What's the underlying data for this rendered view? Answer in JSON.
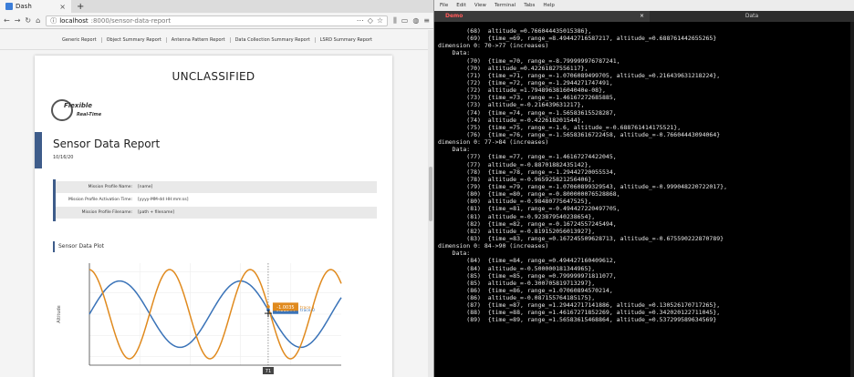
{
  "browser": {
    "tab_title": "Dash",
    "url_host": "localhost",
    "url_rest": ":8000/sensor-data-report"
  },
  "report_nav": [
    "Generic Report",
    "Object Summary Report",
    "Antenna Pattern Report",
    "Data Collection Summary Report",
    "LSRD Summary Report"
  ],
  "report": {
    "classification": "UNCLASSIFIED",
    "logo_brand": "Flexible",
    "logo_sub": "Real-Time",
    "title": "Sensor Data Report",
    "date": "10/16/20",
    "profile": [
      {
        "key": "Mission Profile Name:",
        "value": "[name]"
      },
      {
        "key": "Mission Profile Activation Time:",
        "value": "[yyyy-MM-dd HH:mm:ss]"
      },
      {
        "key": "Mission Profile Filename:",
        "value": "[path + filename]"
      }
    ],
    "plot_heading": "Sensor Data Plot"
  },
  "chart_data": {
    "type": "line",
    "xlabel": "Time (s)",
    "ylabel": "Altitude",
    "xlim": [
      0,
      100
    ],
    "ylim": [
      -1.2,
      1.2
    ],
    "series": [
      {
        "name": "trace 0",
        "color": "#3a73b8",
        "amplitude": 0.78,
        "period": 48,
        "phase": 0.0
      },
      {
        "name": "trace 1",
        "color": "#e08a1e",
        "amplitude": 1.05,
        "period": 32,
        "phase": 1.6
      }
    ],
    "hover": {
      "x": 71,
      "labels": [
        {
          "series": "trace 0",
          "value": "0.21844"
        },
        {
          "series": "trace 1",
          "value": "-1.0035"
        }
      ],
      "x_label": "71"
    }
  },
  "terminal": {
    "menu": [
      "File",
      "Edit",
      "View",
      "Terminal",
      "Tabs",
      "Help"
    ],
    "tabs": [
      {
        "label": "Demo",
        "active": true
      },
      {
        "label": "Data",
        "active": false
      }
    ],
    "close_glyph": "×",
    "lines": [
      "        (68)  altitude_=0.766044435015386},",
      "        (69)  {time_=69, range_=8.49442716587217, altitude_=0.688761442655265}",
      "dimension 0: 70->77 (increases)",
      "    Data:",
      "        (70)  {time_=70, range_=-8.799999976787241,",
      "        (70)  altitude_=0.42261827556117},",
      "        (71)  {time_=71, range_=-1.0706089499705, altitude_=0.216439631218224},",
      "        (72)  {time_=72, range_=-1.2944271747491,",
      "        (72)  altitude_=1.794896381604040e-08},",
      "        (73)  {time_=73, range_=-1.46167272685885,",
      "        (73)  altitude_=-0.216439631217},",
      "        (74)  {time_=74, range_=-1.56583615528287,",
      "        (74)  altitude_=-0.422618201544},",
      "        (75)  {time_=75, range_=-1.6, altitude_=-0.688761414175521},",
      "        (76)  {time_=76, range_=-1.56583616722458, altitude_=-0.76604443094064}",
      "dimension 0: 77->84 (increases)",
      "    Data:",
      "        (77)  {time_=77, range_=-1.46167274422045,",
      "        (77)  altitude_=-0.88701882435142},",
      "        (78)  {time_=78, range_=-1.29442720055534,",
      "        (78)  altitude_=-0.965925821256406},",
      "        (79)  {time_=79, range_=-1.07060899329543, altitude_=-0.999048220722017},",
      "        (80)  {time_=80, range_=-0.800000076528868,",
      "        (80)  altitude_=-0.98480775647525},",
      "        (81)  {time_=81, range_=-0.494427220497705,",
      "        (81)  altitude_=-0.923879540238654},",
      "        (82)  {time_=82, range_=-0.16724557245494,",
      "        (82)  altitude_=-0.819152056013927},",
      "        (83)  {time_=83, range_=0.167245509628713, altitude_=-0.675590222870789}",
      "dimension 0: 84->90 (increases)",
      "    Data:",
      "        (84)  {time_=84, range_=0.494427160409612,",
      "        (84)  altitude_=-0.500000181344965},",
      "        (85)  {time_=85, range_=0.799999971811077,",
      "        (85)  altitude_=-0.300705819713297},",
      "        (86)  {time_=86, range_=1.07060894570214,",
      "        (86)  altitude_=-0.087155764185175},",
      "        (87)  {time_=87, range_=1.29442717141886, altitude_=0.130526170717265},",
      "        (88)  {time_=88, range_=1.46167271852269, altitude_=0.342020122711045},",
      "        (89)  {time_=89, range_=1.56583615468864, altitude_=0.537299589634569}"
    ]
  }
}
